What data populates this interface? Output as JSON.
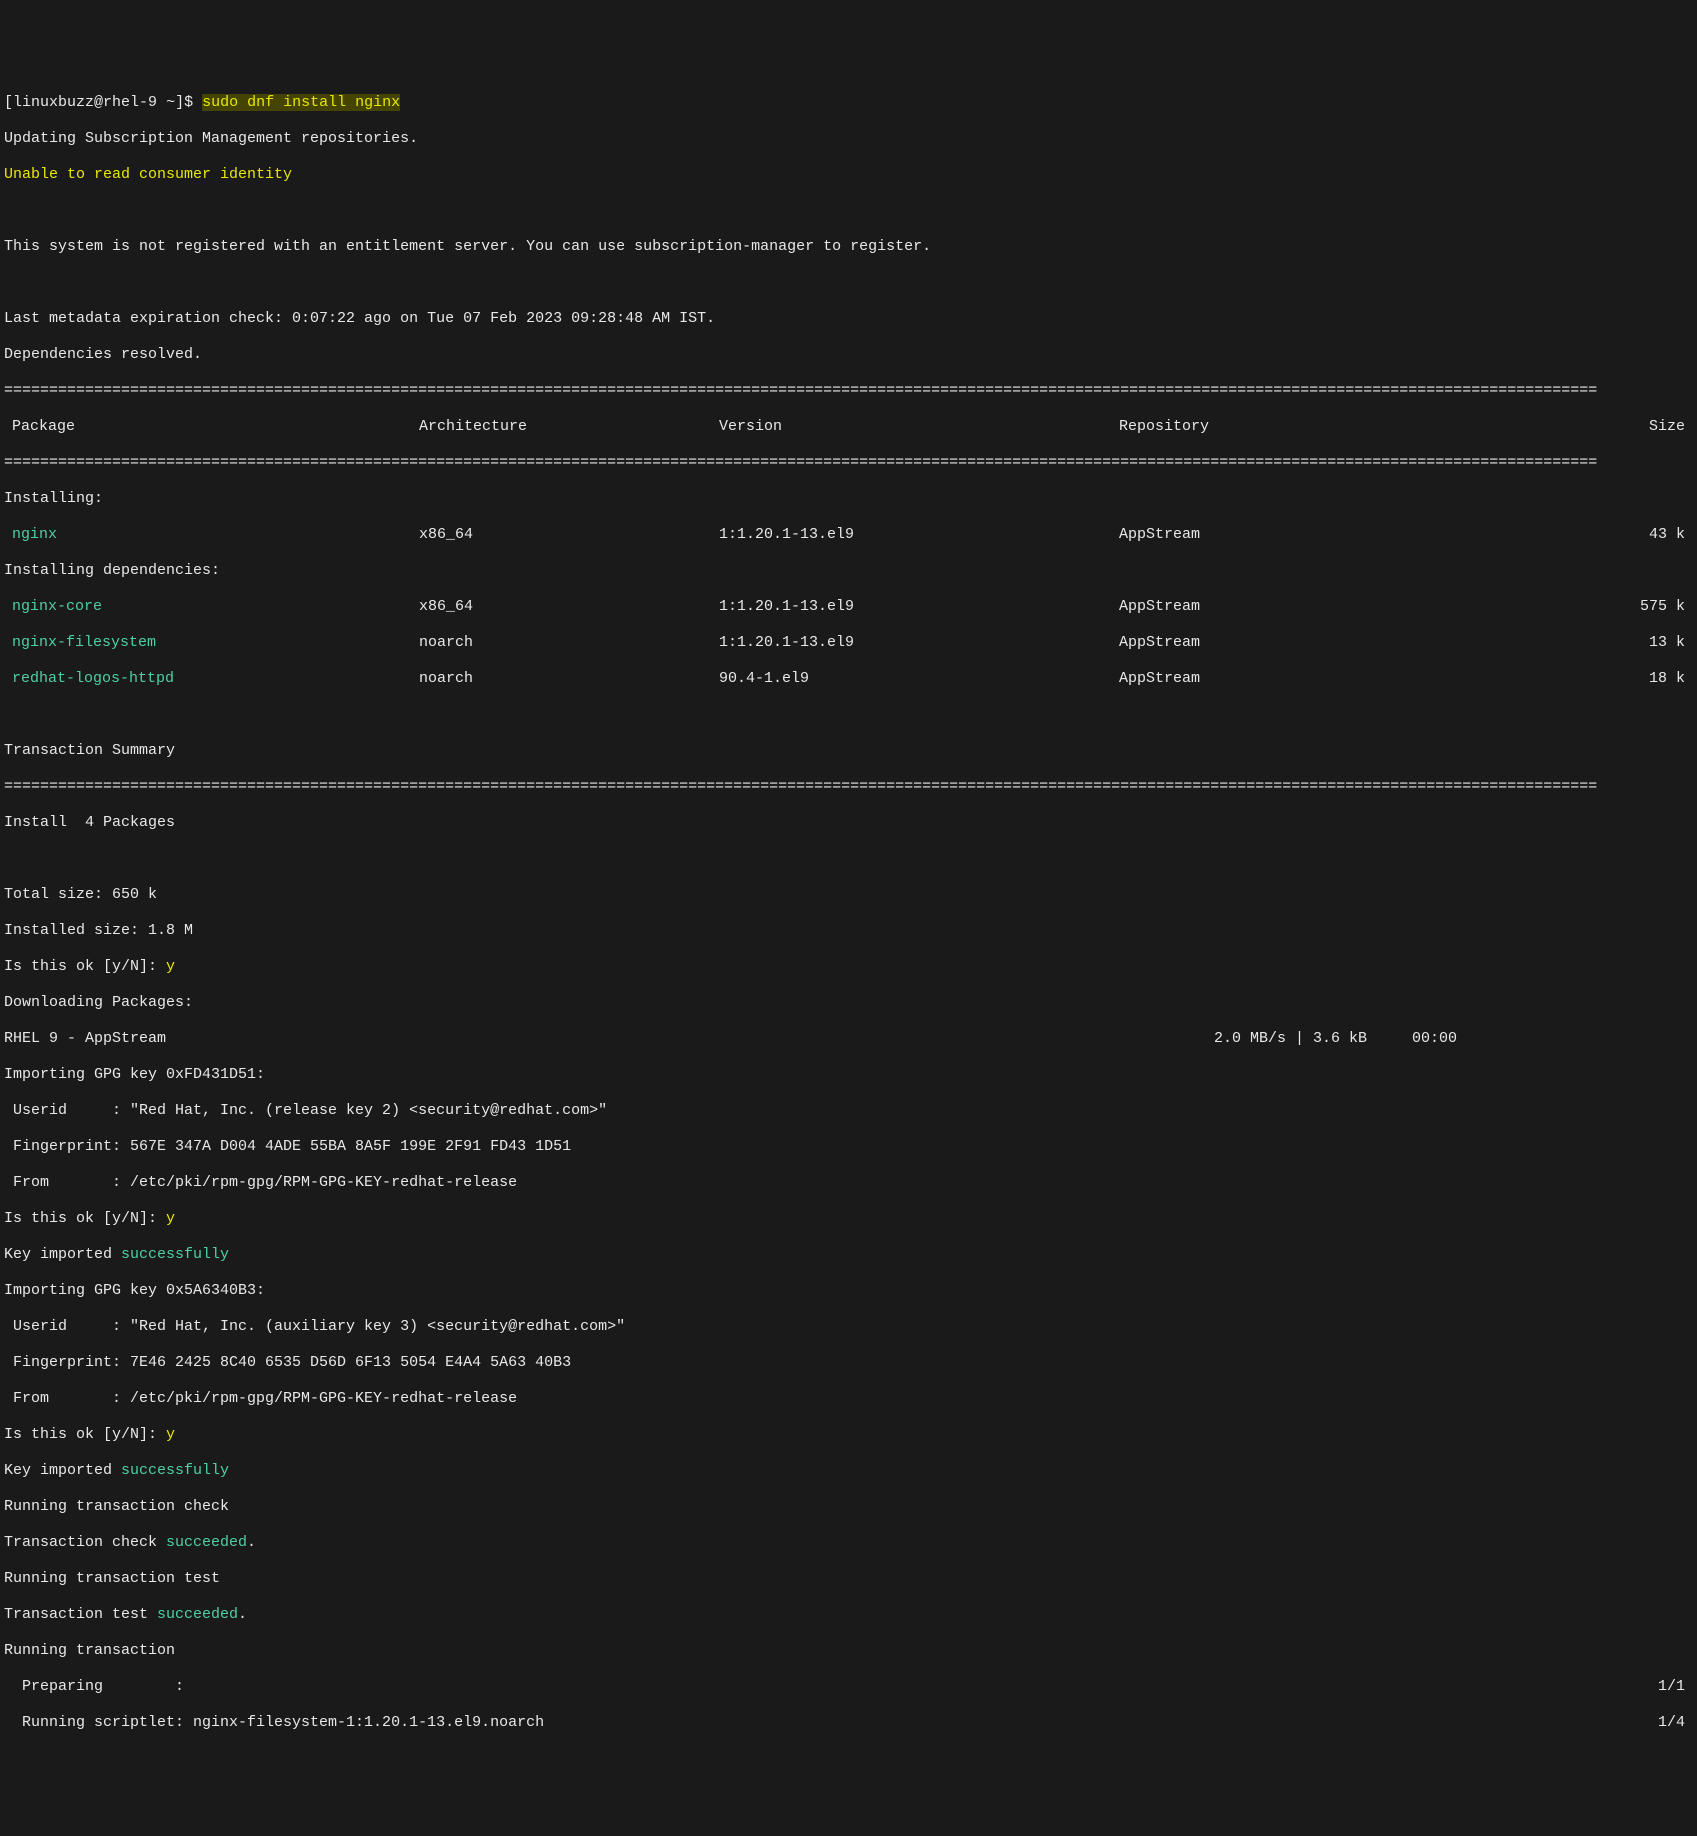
{
  "prompt": {
    "user_host": "linuxbuzz@rhel-9",
    "path": "~",
    "symbol": "$",
    "command": "sudo dnf install nginx"
  },
  "preamble": {
    "line1": "Updating Subscription Management repositories.",
    "line2": "Unable to read consumer identity",
    "line3": "This system is not registered with an entitlement server. You can use subscription-manager to register.",
    "line4": "Last metadata expiration check: 0:07:22 ago on Tue 07 Feb 2023 09:28:48 AM IST.",
    "line5": "Dependencies resolved."
  },
  "headers": {
    "package": "Package",
    "arch": "Architecture",
    "version": "Version",
    "repo": "Repository",
    "size": "Size"
  },
  "sections": {
    "installing": "Installing:",
    "installing_deps": "Installing dependencies:"
  },
  "packages": [
    {
      "name": "nginx",
      "arch": "x86_64",
      "version": "1:1.20.1-13.el9",
      "repo": "AppStream",
      "size": "43 k"
    }
  ],
  "deps": [
    {
      "name": "nginx-core",
      "arch": "x86_64",
      "version": "1:1.20.1-13.el9",
      "repo": "AppStream",
      "size": "575 k"
    },
    {
      "name": "nginx-filesystem",
      "arch": "noarch",
      "version": "1:1.20.1-13.el9",
      "repo": "AppStream",
      "size": "13 k"
    },
    {
      "name": "redhat-logos-httpd",
      "arch": "noarch",
      "version": "90.4-1.el9",
      "repo": "AppStream",
      "size": "18 k"
    }
  ],
  "summary": {
    "title": "Transaction Summary",
    "install": "Install  4 Packages",
    "total_size": "Total size: 650 k",
    "installed_size": "Installed size: 1.8 M"
  },
  "confirm": {
    "prompt": "Is this ok [y/N]: ",
    "answer": "y"
  },
  "downloading": {
    "label": "Downloading Packages:",
    "repo_name": "RHEL 9 - AppStream",
    "stats": "2.0 MB/s | 3.6 kB     00:00"
  },
  "gpg1": {
    "importing": "Importing GPG key 0xFD431D51:",
    "userid": " Userid     : \"Red Hat, Inc. (release key 2) <security@redhat.com>\"",
    "fingerprint": " Fingerprint: 567E 347A D004 4ADE 55BA 8A5F 199E 2F91 FD43 1D51",
    "from": " From       : /etc/pki/rpm-gpg/RPM-GPG-KEY-redhat-release"
  },
  "gpg2": {
    "importing": "Importing GPG key 0x5A6340B3:",
    "userid": " Userid     : \"Red Hat, Inc. (auxiliary key 3) <security@redhat.com>\"",
    "fingerprint": " Fingerprint: 7E46 2425 8C40 6535 D56D 6F13 5054 E4A4 5A63 40B3",
    "from": " From       : /etc/pki/rpm-gpg/RPM-GPG-KEY-redhat-release"
  },
  "key_imported": {
    "prefix": "Key imported ",
    "status": "successfully"
  },
  "transaction": {
    "check_running": "Running transaction check",
    "check_prefix": "Transaction check ",
    "check_status": "succeeded",
    "test_running": "Running transaction test",
    "test_prefix": "Transaction test ",
    "test_status": "succeeded",
    "running": "Running transaction",
    "preparing": "  Preparing        :",
    "preparing_num": "1/1",
    "scriptlet": "  Running scriptlet: nginx-filesystem-1:1.20.1-13.el9.noarch",
    "scriptlet_num": "1/4"
  },
  "period": "."
}
